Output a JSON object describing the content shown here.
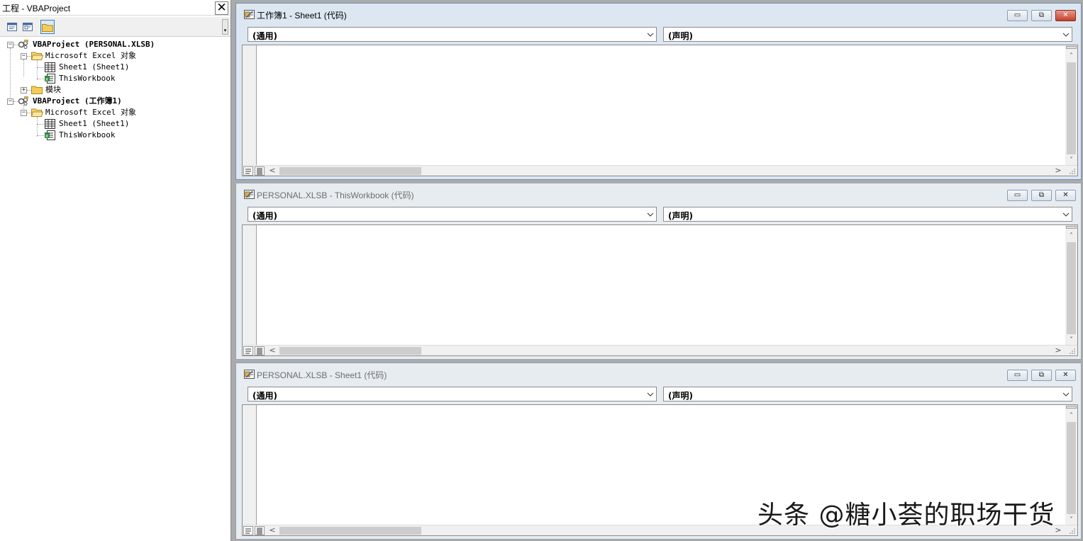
{
  "project_explorer": {
    "title": "工程 - VBAProject",
    "close_glyph": "✕",
    "toolbar": [
      "view-code-icon",
      "view-object-icon",
      "toggle-folders-icon"
    ],
    "tree": [
      {
        "label": "VBAProject (PERSONAL.XLSB)",
        "level": 0,
        "expander": "−",
        "icon": "vbaproject-icon",
        "bold": true
      },
      {
        "label": "Microsoft Excel 对象",
        "level": 1,
        "expander": "−",
        "icon": "folder-open-icon",
        "bold": false
      },
      {
        "label": "Sheet1 (Sheet1)",
        "level": 2,
        "expander": "",
        "icon": "worksheet-icon",
        "bold": false
      },
      {
        "label": "ThisWorkbook",
        "level": 2,
        "expander": "",
        "icon": "workbook-icon",
        "bold": false
      },
      {
        "label": "模块",
        "level": 1,
        "expander": "+",
        "icon": "folder-icon",
        "bold": false
      },
      {
        "label": "VBAProject (工作簿1)",
        "level": 0,
        "expander": "−",
        "icon": "vbaproject-icon",
        "bold": true
      },
      {
        "label": "Microsoft Excel 对象",
        "level": 1,
        "expander": "−",
        "icon": "folder-open-icon",
        "bold": false
      },
      {
        "label": "Sheet1 (Sheet1)",
        "level": 2,
        "expander": "",
        "icon": "worksheet-icon",
        "bold": false
      },
      {
        "label": "ThisWorkbook",
        "level": 2,
        "expander": "",
        "icon": "workbook-icon",
        "bold": false
      }
    ]
  },
  "code_windows": [
    {
      "title": "工作簿1 - Sheet1 (代码)",
      "active": true,
      "object_combo": "(通用)",
      "procedure_combo": "(声明)"
    },
    {
      "title": "PERSONAL.XLSB - ThisWorkbook (代码)",
      "active": false,
      "object_combo": "(通用)",
      "procedure_combo": "(声明)"
    },
    {
      "title": "PERSONAL.XLSB - Sheet1 (代码)",
      "active": false,
      "object_combo": "(通用)",
      "procedure_combo": "(声明)"
    }
  ],
  "window_controls": {
    "minimize": "▭",
    "restore": "⧉",
    "close": "✕"
  },
  "scroll_glyphs": {
    "up": "˄",
    "down": "˅",
    "left": "<",
    "right": ">"
  },
  "watermark": "头条 @糖小荟的职场干货",
  "colors": {
    "mdi_background": "#ababab",
    "active_title": "#dde7f1",
    "inactive_title": "#e7ecf1",
    "close_active": "#c4402c"
  }
}
